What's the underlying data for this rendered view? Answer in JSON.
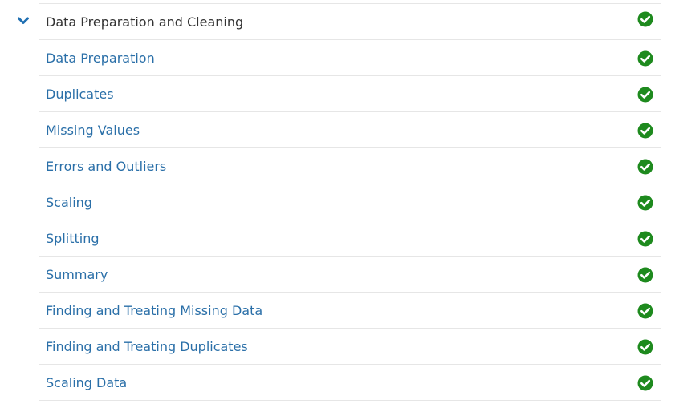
{
  "section": {
    "title": "Data Preparation and Cleaning",
    "expanded": true,
    "expand_icon": "chevron-down-icon",
    "status_icon": "check-circle-icon",
    "status": "complete"
  },
  "items": [
    {
      "label": "Data Preparation",
      "status": "complete"
    },
    {
      "label": "Duplicates",
      "status": "complete"
    },
    {
      "label": "Missing Values",
      "status": "complete"
    },
    {
      "label": "Errors and Outliers",
      "status": "complete"
    },
    {
      "label": "Scaling",
      "status": "complete"
    },
    {
      "label": "Splitting",
      "status": "complete"
    },
    {
      "label": "Summary",
      "status": "complete"
    },
    {
      "label": "Finding and Treating Missing Data",
      "status": "complete"
    },
    {
      "label": "Finding and Treating Duplicates",
      "status": "complete"
    },
    {
      "label": "Scaling Data",
      "status": "complete"
    }
  ],
  "colors": {
    "link": "#2a6fa8",
    "title": "#333333",
    "chevron": "#1f6fb2",
    "check": "#1e8a1e",
    "divider": "#e6e6e6"
  }
}
